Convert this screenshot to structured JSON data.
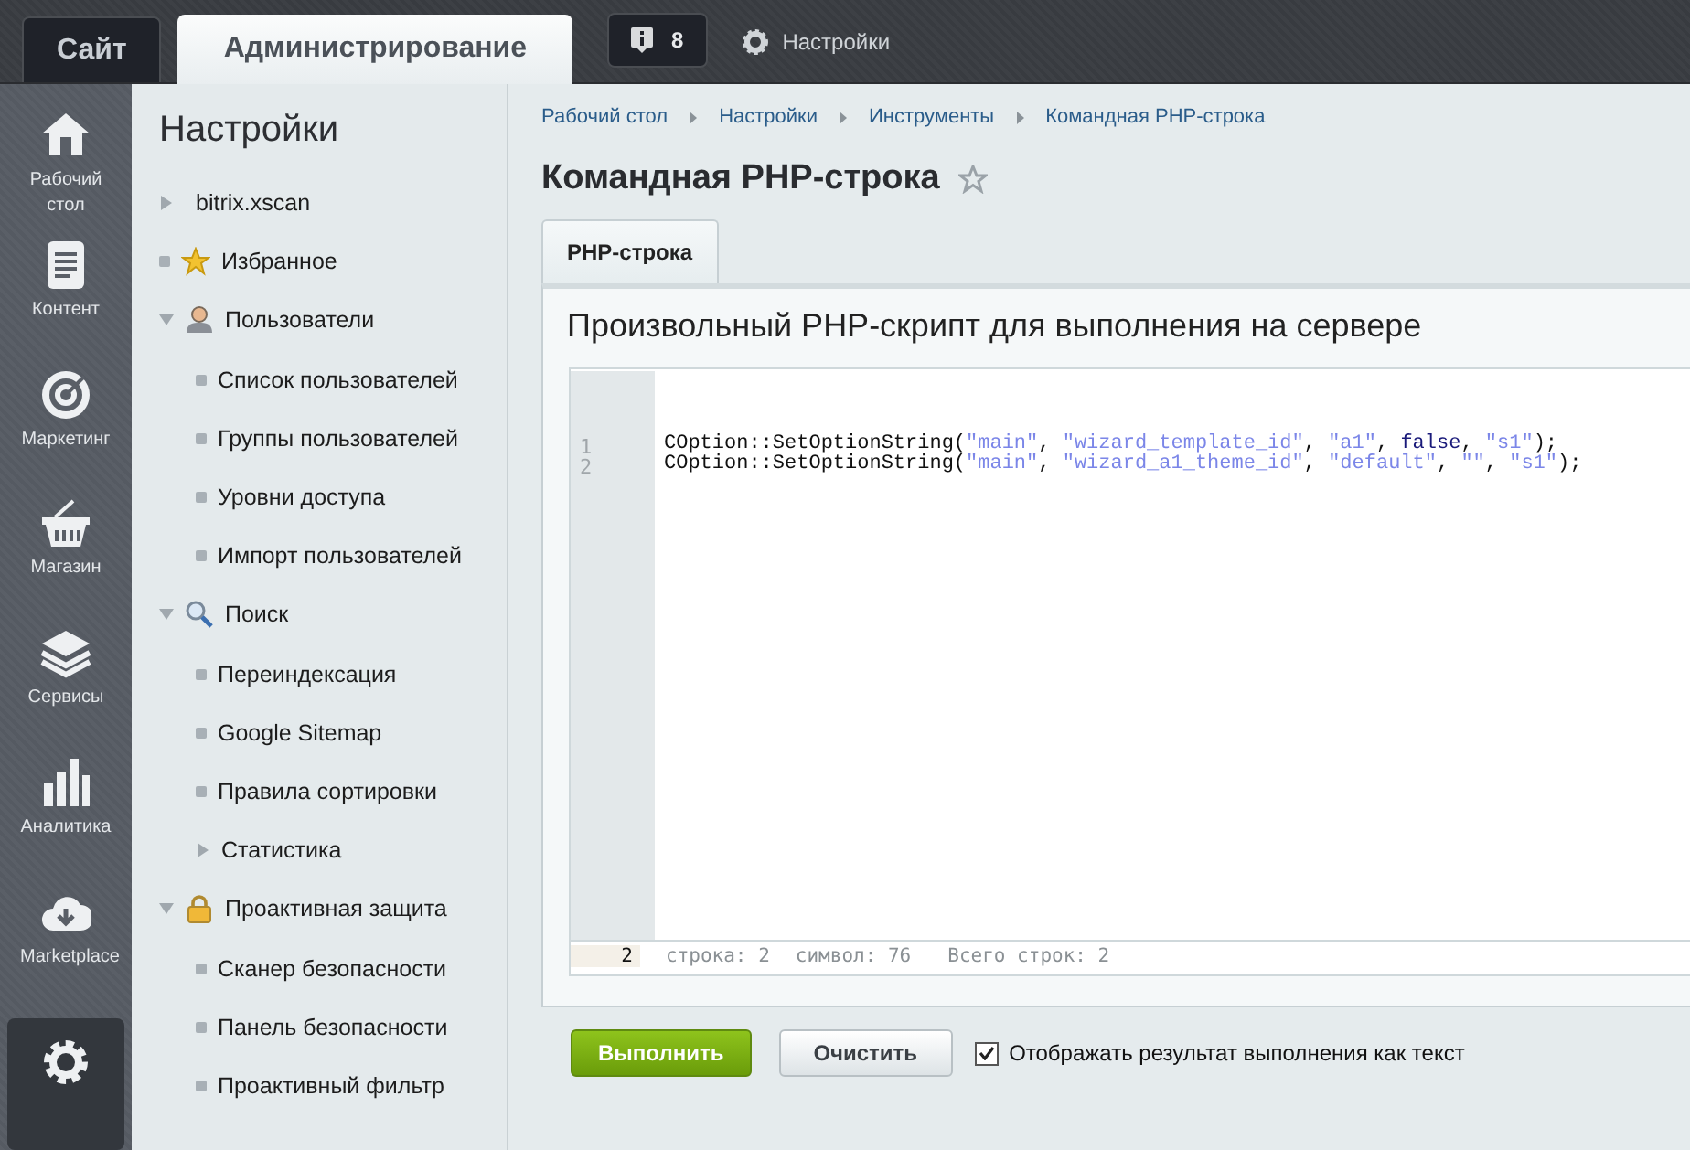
{
  "top_bar": {
    "tabs": [
      {
        "label": "Сайт",
        "selected": false
      },
      {
        "label": "Администрирование",
        "selected": true
      }
    ],
    "notifications": {
      "count": "8"
    },
    "settings_link": "Настройки"
  },
  "nav": [
    {
      "kind": "house",
      "label": "Рабочий стол",
      "selected": false
    },
    {
      "kind": "document",
      "label": "Контент",
      "selected": false
    },
    {
      "kind": "target",
      "label": "Маркетинг",
      "selected": false
    },
    {
      "kind": "basket",
      "label": "Магазин",
      "selected": false
    },
    {
      "kind": "layers",
      "label": "Сервисы",
      "selected": false
    },
    {
      "kind": "bars",
      "label": "Аналитика",
      "selected": false
    },
    {
      "kind": "cloud",
      "label": "Marketplace",
      "selected": false
    },
    {
      "kind": "gear",
      "selected": true
    }
  ],
  "sidebar": {
    "title": "Настройки",
    "items": [
      {
        "kind": "section",
        "label": "bitrix.xscan",
        "expanded": false
      },
      {
        "kind": "favorites",
        "label": "Избранное"
      },
      {
        "kind": "users",
        "label": "Пользователи",
        "expanded": true,
        "children": [
          {
            "kind": "link",
            "label": "Список пользователей"
          },
          {
            "kind": "link",
            "label": "Группы пользователей"
          },
          {
            "kind": "link",
            "label": "Уровни доступа"
          },
          {
            "kind": "link",
            "label": "Импорт пользователей"
          }
        ]
      },
      {
        "kind": "search",
        "label": "Поиск",
        "expanded": true,
        "children": [
          {
            "kind": "link",
            "label": "Переиндексация"
          },
          {
            "kind": "link",
            "label": "Google Sitemap"
          },
          {
            "kind": "link",
            "label": "Правила сортировки"
          },
          {
            "kind": "section",
            "label": "Статистика",
            "expanded": false
          }
        ]
      },
      {
        "kind": "security",
        "label": "Проактивная защита",
        "expanded": true,
        "children": [
          {
            "kind": "link",
            "label": "Сканер безопасности"
          },
          {
            "kind": "link",
            "label": "Панель безопасности"
          },
          {
            "kind": "link",
            "label": "Проактивный фильтр"
          }
        ]
      }
    ]
  },
  "breadcrumbs": [
    "Рабочий стол",
    "Настройки",
    "Инструменты",
    "Командная PHP-строка"
  ],
  "page_title": "Командная PHP-строка",
  "tabs": [
    {
      "label": "PHP-строка",
      "selected": true
    }
  ],
  "panel": {
    "heading": "Произвольный PHP-скрипт для выполнения на сервере",
    "editor": {
      "lines": [
        {
          "number": "1",
          "tokens": [
            {
              "kind": "plain",
              "text": "COption::SetOptionString("
            },
            {
              "kind": "string",
              "text": "\"main\""
            },
            {
              "kind": "plain",
              "text": ", "
            },
            {
              "kind": "string",
              "text": "\"wizard_template_id\""
            },
            {
              "kind": "plain",
              "text": ", "
            },
            {
              "kind": "string",
              "text": "\"a1\""
            },
            {
              "kind": "plain",
              "text": ", "
            },
            {
              "kind": "keyword",
              "text": "false"
            },
            {
              "kind": "plain",
              "text": ", "
            },
            {
              "kind": "string",
              "text": "\"s1\""
            },
            {
              "kind": "plain",
              "text": ");"
            }
          ]
        },
        {
          "number": "2",
          "tokens": [
            {
              "kind": "plain",
              "text": "COption::SetOptionString("
            },
            {
              "kind": "string",
              "text": "\"main\""
            },
            {
              "kind": "plain",
              "text": ", "
            },
            {
              "kind": "string",
              "text": "\"wizard_a1_theme_id\""
            },
            {
              "kind": "plain",
              "text": ", "
            },
            {
              "kind": "string",
              "text": "\"default\""
            },
            {
              "kind": "plain",
              "text": ", "
            },
            {
              "kind": "string",
              "text": "\"\""
            },
            {
              "kind": "plain",
              "text": ", "
            },
            {
              "kind": "string",
              "text": "\"s1\""
            },
            {
              "kind": "plain",
              "text": ");"
            }
          ]
        }
      ],
      "status": {
        "current_line": "2",
        "line": "строка: 2",
        "column": "символ: 76",
        "total": "Всего строк: 2"
      }
    }
  },
  "actions": {
    "run_button": "Выполнить",
    "clear_button": "Очистить",
    "as_text": {
      "label": "Отображать результат выполнения как текст",
      "checked": true
    }
  }
}
